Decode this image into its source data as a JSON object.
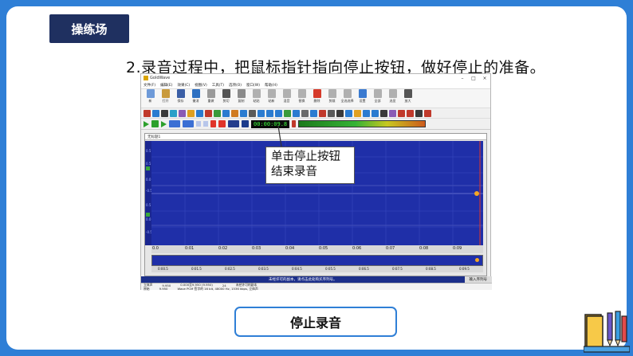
{
  "slide": {
    "tag": "操练场",
    "heading": "2.录音过程中，把鼠标指针指向停止按钮，做好停止的准备。",
    "callout_line1": "单击停止按钮",
    "callout_line2": "结束录音",
    "action_label": "停止录音"
  },
  "app": {
    "title": "GoldWave",
    "window_buttons": [
      "–",
      "□",
      "×"
    ],
    "menus": [
      "文件(F)",
      "编辑(E)",
      "效果(C)",
      "视图(V)",
      "工具(T)",
      "选项(O)",
      "窗口(W)",
      "帮助(H)"
    ],
    "toolbar": [
      {
        "label": "新",
        "icon": "new-file-icon",
        "color": "#6e9ad8"
      },
      {
        "label": "打开",
        "icon": "open-folder-icon",
        "color": "#c99a3b"
      },
      {
        "label": "保存",
        "icon": "save-icon",
        "color": "#3b5fa6"
      },
      {
        "label": "撤消",
        "icon": "undo-icon",
        "color": "#2c6fc1"
      },
      {
        "label": "重做",
        "icon": "redo-icon",
        "color": "#9a9a9a"
      },
      {
        "label": "剪切",
        "icon": "cut-icon",
        "color": "#555555"
      },
      {
        "label": "复制",
        "icon": "copy-icon",
        "color": "#8a8a8a"
      },
      {
        "label": "粘贴",
        "icon": "paste-icon",
        "color": "#b0b0b0"
      },
      {
        "label": "粘新",
        "icon": "paste-new-icon",
        "color": "#b0b0b0"
      },
      {
        "label": "混音",
        "icon": "mix-icon",
        "color": "#b0b0b0"
      },
      {
        "label": "替换",
        "icon": "replace-icon",
        "color": "#b0b0b0"
      },
      {
        "label": "删除",
        "icon": "delete-icon",
        "color": "#d63a2a"
      },
      {
        "label": "剪裁",
        "icon": "trim-icon",
        "color": "#b0b0b0"
      },
      {
        "label": "全选选择",
        "icon": "select-all-icon",
        "color": "#b0b0b0"
      },
      {
        "label": "设置",
        "icon": "settings-icon",
        "color": "#3a7ad0"
      },
      {
        "label": "全部",
        "icon": "all-icon",
        "color": "#b0b0b0"
      },
      {
        "label": "选显",
        "icon": "select-view-icon",
        "color": "#b0b0b0"
      },
      {
        "label": "放大",
        "icon": "zoom-in-icon",
        "color": "#555555"
      }
    ],
    "counter": "00:00:09.8",
    "doc_title": "无标题1",
    "left_scale": [
      "0.5",
      "0.5",
      "0.0",
      "-0.5",
      "0.5",
      "0.0",
      "-0.5"
    ],
    "time_ticks": [
      "0.0",
      "0:01",
      "0:02",
      "0:03",
      "0:04",
      "0:05",
      "0:06",
      "0:07",
      "0:08",
      "0:09"
    ],
    "overview_ticks": [
      "0:00.5",
      "0:01.5",
      "0:02.5",
      "0:03.5",
      "0:04.5",
      "0:05.5",
      "0:06.5",
      "0:07.5",
      "0:08.5",
      "0:09.5"
    ],
    "status_message": "未经许可的副本，请点击此处购买序列号。",
    "status_button": "输入序列号",
    "info": {
      "row1": [
        "立体声",
        "9.950",
        "0.000至9.950 (9.950)",
        "24",
        "未经许可的副本"
      ],
      "row2": [
        "原始",
        "9.950",
        "Wave PCM 签字的 16 bit, 48000 Hz, 1536 kbps, 立体声"
      ]
    }
  },
  "colors": {
    "page_bg": "#2f7fd6",
    "tag_bg": "#1f3060",
    "wave_bg": "#1f2fa8",
    "accent_blue": "#2f7fd6"
  }
}
